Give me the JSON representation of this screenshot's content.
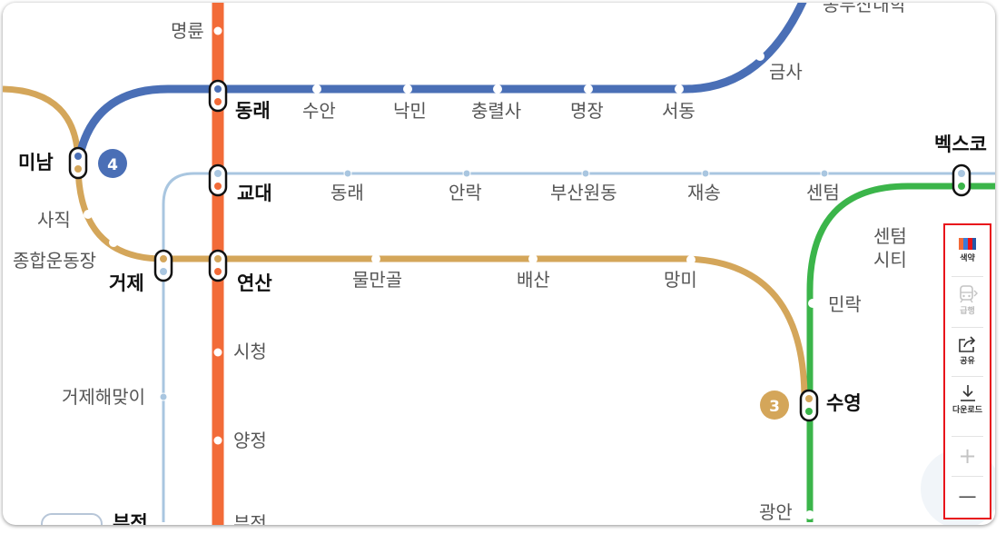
{
  "map": {
    "line_colors": {
      "line1": "#f26b38",
      "line2": "#3bb54a",
      "line3": "#d4a65a",
      "line4": "#4a6fb6",
      "donghae": "#a9c6e0"
    },
    "stations": {
      "myeongnyun": "명륜",
      "dongnae": "동래",
      "suan": "수안",
      "nangmin": "낙민",
      "chungnyeolsa": "충렬사",
      "myeongjang": "명장",
      "seodong": "서동",
      "geumsa": "금사",
      "dongbusan_partial": "동부산대학",
      "minam": "미남",
      "sajik": "사직",
      "sports_complex": "종합운동장",
      "geoje": "거제",
      "yeonsan": "연산",
      "mulmangol": "물만골",
      "baesan": "배산",
      "mangmi": "망미",
      "suyeong": "수영",
      "gyodae": "교대",
      "dongnae_donghae": "동래",
      "anrak": "안락",
      "busanwondong": "부산원동",
      "jaesong": "재송",
      "centum": "센텀",
      "bexco": "벡스코",
      "centum_city_1": "센텀",
      "centum_city_2": "시티",
      "millak": "민락",
      "gwangan": "광안",
      "geoje_haemaji": "거제해맞이",
      "sicheong": "시청",
      "yangjeong": "양정",
      "bujeon": "부전",
      "bujeon_2": "부전"
    },
    "line_badges": {
      "line4": "4",
      "line3": "3"
    }
  },
  "toolbar": {
    "colorblind_label": "색약",
    "express_label": "급행",
    "share_label": "공유",
    "download_label": "다운로드",
    "zoom_in_label": "+",
    "zoom_out_label": "—"
  }
}
